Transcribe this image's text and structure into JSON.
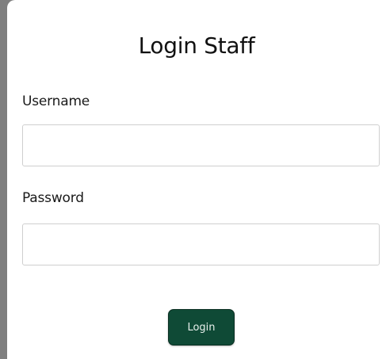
{
  "form": {
    "title": "Login Staff",
    "username_label": "Username",
    "username_value": "",
    "password_label": "Password",
    "password_value": "",
    "login_button": "Login"
  },
  "colors": {
    "background": "#7f7f7f",
    "card": "#ffffff",
    "button": "#0f4a36",
    "input_border": "#cfcfcf"
  }
}
